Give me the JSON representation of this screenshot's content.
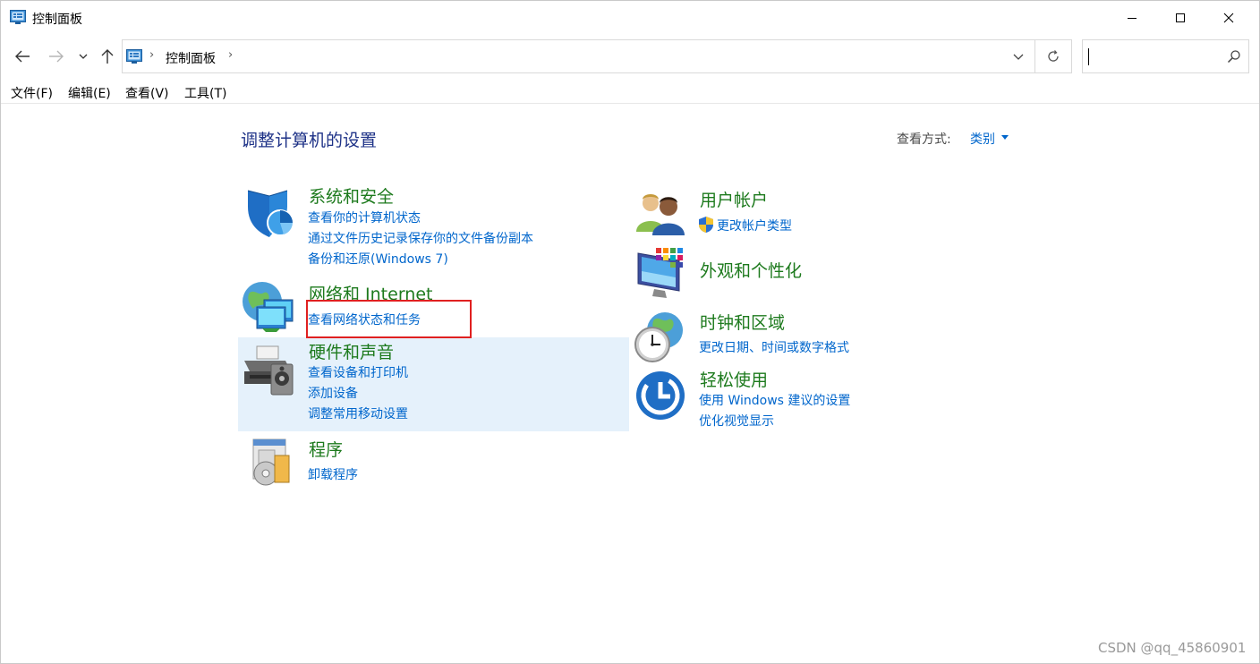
{
  "window": {
    "title": "控制面板"
  },
  "address": {
    "crumb": "控制面板",
    "search_placeholder": ""
  },
  "menu": [
    "文件(F)",
    "编辑(E)",
    "查看(V)",
    "工具(T)"
  ],
  "main": {
    "heading": "调整计算机的设置",
    "view_by_label": "查看方式:",
    "view_by_value": "类别"
  },
  "categories": {
    "system": {
      "title": "系统和安全",
      "links": [
        "查看你的计算机状态",
        "通过文件历史记录保存你的文件备份副本",
        "备份和还原(Windows 7)"
      ]
    },
    "network": {
      "title": "网络和 Internet",
      "links": [
        "查看网络状态和任务"
      ]
    },
    "hardware": {
      "title": "硬件和声音",
      "links": [
        "查看设备和打印机",
        "添加设备",
        "调整常用移动设置"
      ]
    },
    "programs": {
      "title": "程序",
      "links": [
        "卸载程序"
      ]
    },
    "users": {
      "title": "用户帐户",
      "links": [
        "更改帐户类型"
      ]
    },
    "appearance": {
      "title": "外观和个性化",
      "links": []
    },
    "clock": {
      "title": "时钟和区域",
      "links": [
        "更改日期、时间或数字格式"
      ]
    },
    "ease": {
      "title": "轻松使用",
      "links": [
        "使用 Windows 建议的设置",
        "优化视觉显示"
      ]
    }
  },
  "watermark": "CSDN @qq_45860901",
  "colors": {
    "link": "#0066cc",
    "category_title": "#1d7a1d",
    "heading": "#1e3287",
    "highlight": "#e02020",
    "hover_bg": "#e5f1fb"
  }
}
